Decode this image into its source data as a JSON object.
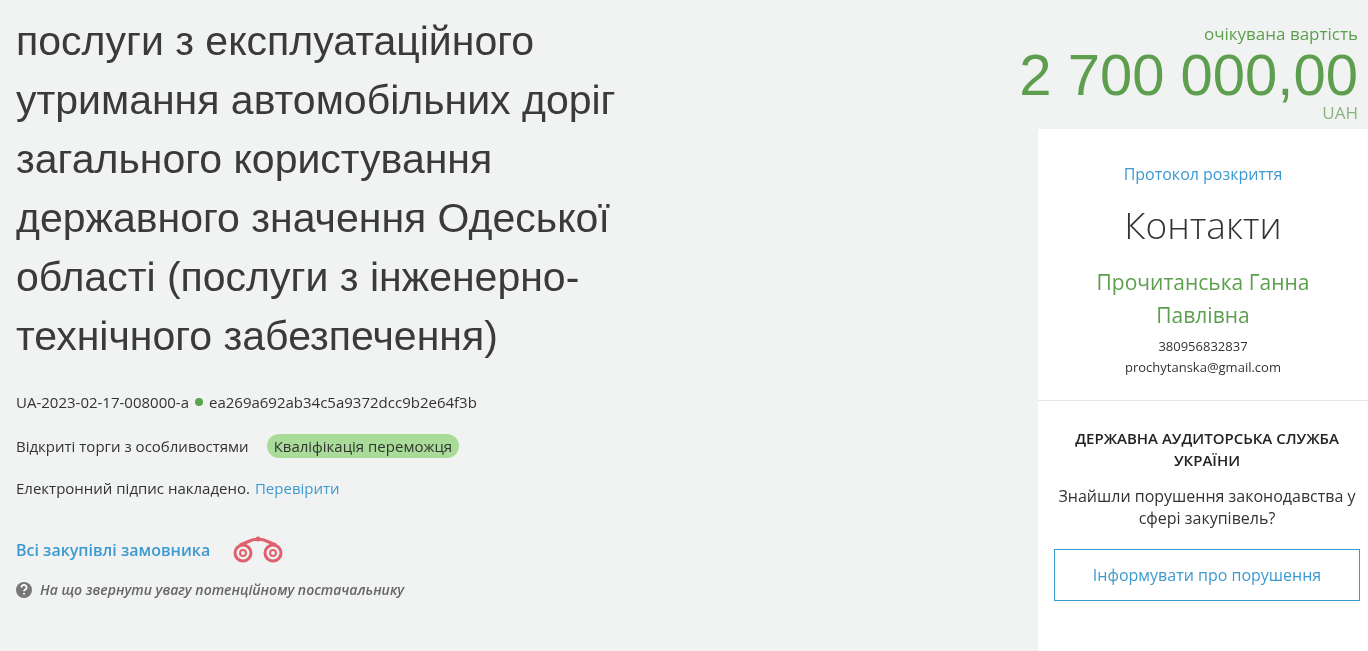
{
  "tender": {
    "title": "послуги з експлуатаційного утримання автомобільних доріг загального користування державного значення Одеської області (послуги з інженерно-технічного забезпечення)",
    "id": "UA-2023-02-17-008000-a",
    "hash": "ea269a692ab34c5a9372dcc9b2e64f3b",
    "procedure": "Відкриті торги з особливостями",
    "status": "Кваліфікація переможця",
    "signature": "Електронний підпис накладено.",
    "signature_link": "Перевірити",
    "buyer_link": "Всі закупівлі замовника",
    "hint": "На що звернути увагу потенційному постачальнику"
  },
  "price": {
    "label": "очікувана вартість",
    "amount": "2 700 000,00",
    "currency": "UAH"
  },
  "contacts": {
    "protocol_link": "Протокол розкриття",
    "title": "Контакти",
    "name": "Прочитанська Ганна Павлівна",
    "phone": "380956832837",
    "email": "prochytanska@gmail.com"
  },
  "audit": {
    "title": "ДЕРЖАВНА АУДИТОРСЬКА СЛУЖБА УКРАЇНИ",
    "question": "Знайшли порушення законодавства у сфері закупівель?",
    "button": "Інформувати про порушення"
  }
}
